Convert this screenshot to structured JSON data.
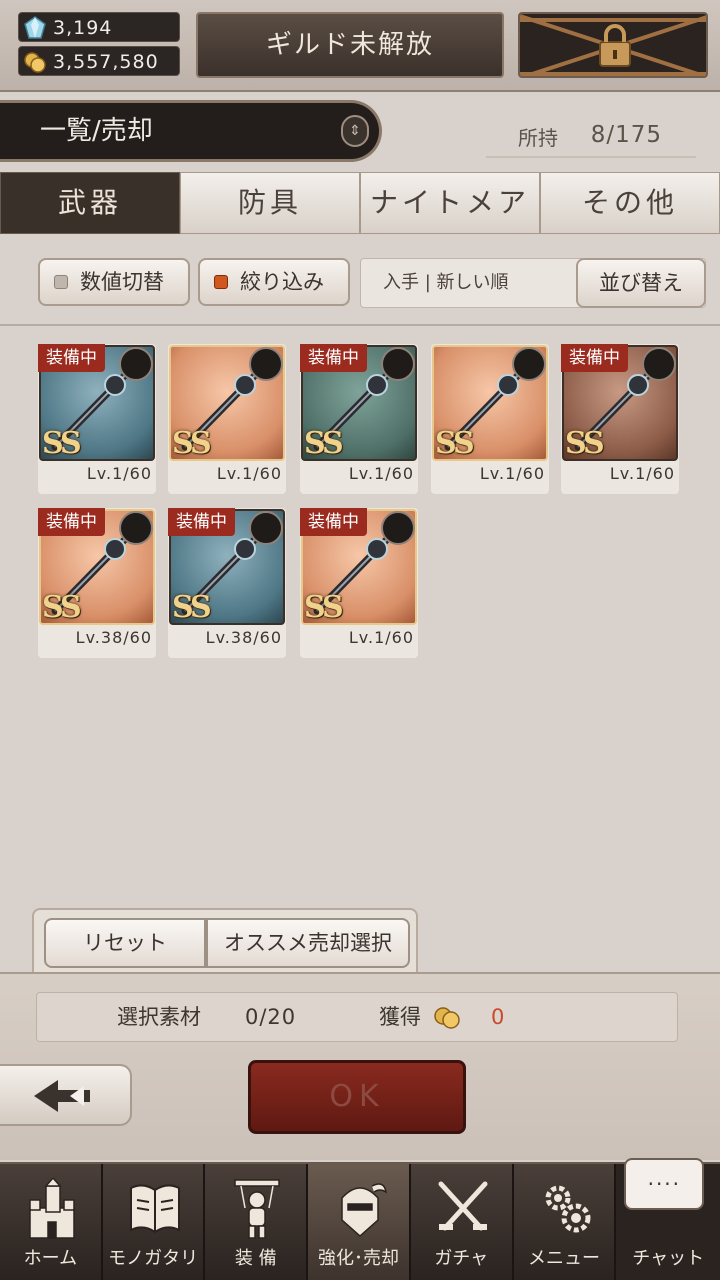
{
  "header": {
    "gems": "3,194",
    "gold": "3,557,580",
    "guild_button": "ギルド未解放"
  },
  "list": {
    "title": "一覧/売却",
    "owned_label": "所持",
    "owned_value": "8/175"
  },
  "tabs": [
    {
      "label": "武器",
      "active": true
    },
    {
      "label": "防具",
      "active": false
    },
    {
      "label": "ナイトメア",
      "active": false
    },
    {
      "label": "その他",
      "active": false
    }
  ],
  "filters": {
    "value_toggle": "数値切替",
    "filter": "絞り込み",
    "sort_current": "入手 | 新しい順",
    "sort_button": "並び替え"
  },
  "items": [
    {
      "equipped": "装備中",
      "rank": "SS",
      "level": "Lv.1/60",
      "type_icon": "sword-icon",
      "color": "blue"
    },
    {
      "equipped": "",
      "rank": "SS",
      "level": "Lv.1/60",
      "type_icon": "harp-icon",
      "color": "orange"
    },
    {
      "equipped": "装備中",
      "rank": "SS",
      "level": "Lv.1/60",
      "type_icon": "skull-icon",
      "color": "green"
    },
    {
      "equipped": "",
      "rank": "SS",
      "level": "Lv.1/60",
      "type_icon": "staff-icon",
      "color": "orange"
    },
    {
      "equipped": "装備中",
      "rank": "SS",
      "level": "Lv.1/60",
      "type_icon": "skull-icon",
      "color": "brown"
    },
    {
      "equipped": "装備中",
      "rank": "SS",
      "level": "Lv.38/60",
      "type_icon": "staff-icon",
      "color": "orange"
    },
    {
      "equipped": "装備中",
      "rank": "SS",
      "level": "Lv.38/60",
      "type_icon": "spear-icon",
      "color": "blue"
    },
    {
      "equipped": "装備中",
      "rank": "SS",
      "level": "Lv.1/60",
      "type_icon": "skull-icon",
      "color": "orange"
    }
  ],
  "actions": {
    "reset": "リセット",
    "recommend_sell": "オススメ売却選択",
    "selected_label": "選択素材",
    "selected_value": "0/20",
    "gain_label": "獲得",
    "gain_value": "0",
    "ok": "OK"
  },
  "nav": [
    {
      "label": "ホーム",
      "icon": "castle-icon"
    },
    {
      "label": "モノガタリ",
      "icon": "book-icon"
    },
    {
      "label": "装 備",
      "icon": "puppet-icon"
    },
    {
      "label": "強化･売却",
      "icon": "helmet-icon",
      "active": true
    },
    {
      "label": "ガチャ",
      "icon": "crossed-swords-icon"
    },
    {
      "label": "メニュー",
      "icon": "gears-icon"
    }
  ],
  "chat": {
    "bubble": "....",
    "label": "チャット"
  }
}
